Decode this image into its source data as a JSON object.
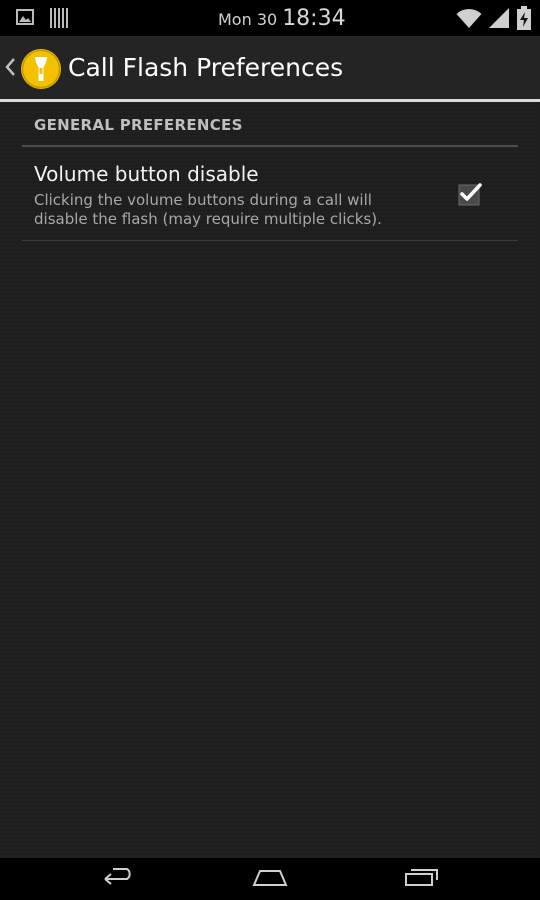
{
  "status_bar": {
    "date": "Mon 30",
    "time": "18:34",
    "icons": [
      "image-notification-icon",
      "barcode-notification-icon",
      "wifi-icon",
      "signal-icon",
      "battery-charging-icon"
    ]
  },
  "action_bar": {
    "title": "Call Flash Preferences",
    "app_icon": "flashlight-app-icon",
    "up_icon": "back-chevron-icon"
  },
  "preferences": {
    "category": "GENERAL PREFERENCES",
    "items": [
      {
        "title": "Volume button disable",
        "summary": "Clicking the volume buttons during a call will disable the flash (may require multiple clicks).",
        "checked": true
      }
    ]
  },
  "nav_bar": {
    "buttons": [
      "back-icon",
      "home-icon",
      "recents-icon"
    ]
  },
  "colors": {
    "accent": "#f2c200",
    "background": "#1e1e1e",
    "action_bar": "#242424"
  }
}
